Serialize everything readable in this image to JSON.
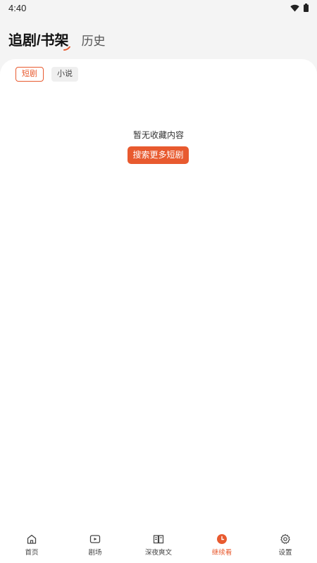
{
  "status_bar": {
    "time": "4:40",
    "wifi_icon": "wifi-icon",
    "battery_icon": "battery-icon"
  },
  "header": {
    "active_tab": "追剧/书架",
    "inactive_tab": "历史"
  },
  "filters": [
    {
      "label": "短剧",
      "active": true
    },
    {
      "label": "小说",
      "active": false
    }
  ],
  "empty_state": {
    "message": "暂无收藏内容",
    "button_label": "搜索更多短剧"
  },
  "bottom_nav": [
    {
      "label": "首页",
      "icon": "home-icon",
      "active": false
    },
    {
      "label": "剧场",
      "icon": "play-screen-icon",
      "active": false
    },
    {
      "label": "深夜爽文",
      "icon": "book-icon",
      "active": false
    },
    {
      "label": "继续看",
      "icon": "clock-icon",
      "active": true
    },
    {
      "label": "设置",
      "icon": "gear-icon",
      "active": false
    }
  ],
  "colors": {
    "accent": "#e85a2f",
    "background": "#f4f4f4",
    "card": "#ffffff"
  }
}
